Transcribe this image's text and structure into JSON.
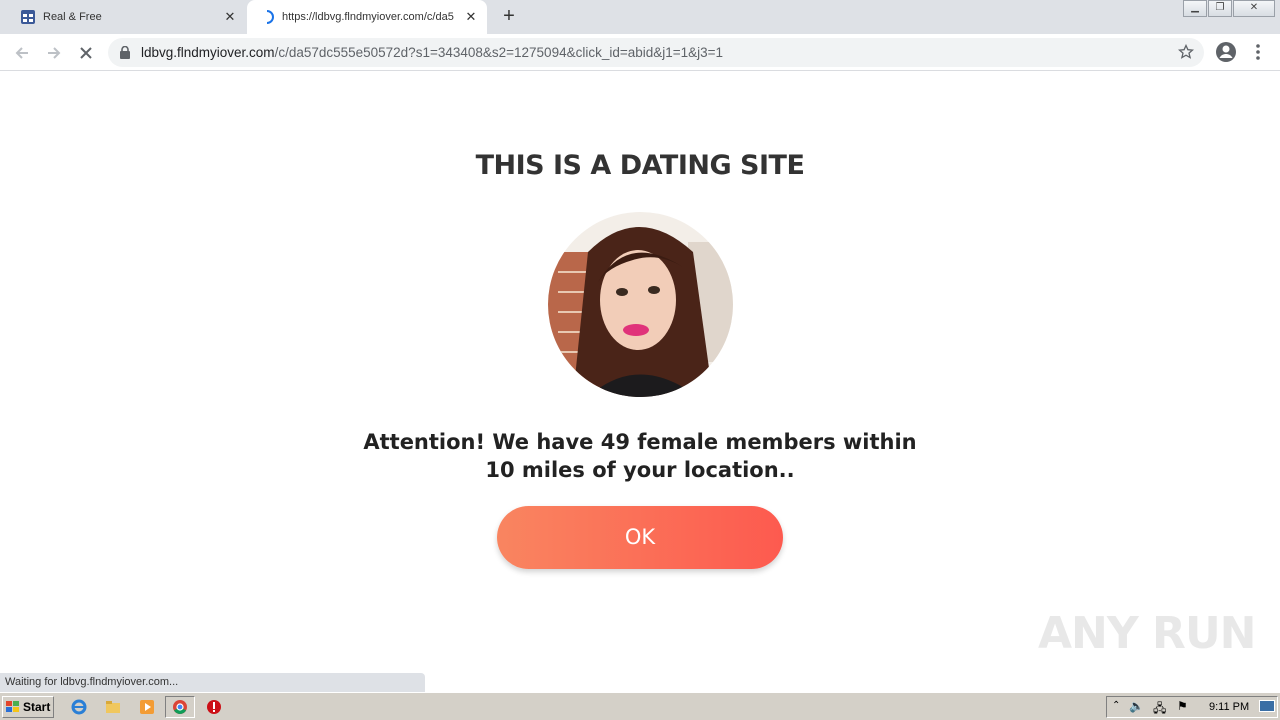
{
  "browser": {
    "tabs": [
      {
        "title": "Real & Free",
        "active": false
      },
      {
        "title": "https://ldbvg.flndmyiover.com/c/da5",
        "active": true
      }
    ],
    "address": {
      "host": "ldbvg.flndmyiover.com",
      "path": "/c/da57dc555e50572d?s1=343408&s2=1275094&click_id=abid&j1=1&j3=1"
    },
    "status_text": "Waiting for ldbvg.flndmyiover.com..."
  },
  "page": {
    "headline": "THIS IS A DATING SITE",
    "message": "Attention! We have 49 female members within 10 miles of your location..",
    "ok_label": "OK",
    "watermark": "ANY RUN"
  },
  "taskbar": {
    "start_label": "Start",
    "clock": "9:11 PM"
  },
  "colors": {
    "button_gradient_start": "#f98560",
    "button_gradient_end": "#fd5a4f",
    "headline": "#333333"
  }
}
